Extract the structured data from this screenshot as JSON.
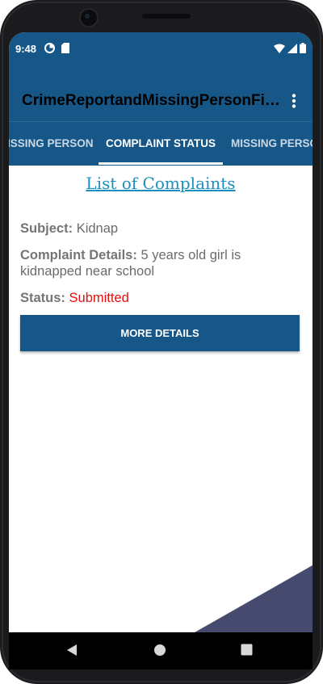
{
  "status_bar": {
    "time": "9:48",
    "left_icons": [
      "data-saver-icon",
      "sd-card-icon"
    ],
    "right_icons": [
      "wifi-icon",
      "signal-icon",
      "battery-icon"
    ]
  },
  "app_bar": {
    "title": "CrimeReportandMissingPersonFin…",
    "menu_icon": "more-vert-icon"
  },
  "tabs": [
    {
      "label": "ISSING PERSON",
      "selected": false
    },
    {
      "label": "COMPLAINT STATUS",
      "selected": true
    },
    {
      "label": "MISSING PERSO",
      "selected": false
    }
  ],
  "content": {
    "heading": "List of Complaints",
    "subject_label": "Subject:",
    "subject_value": "Kidnap",
    "details_label": "Complaint Details:",
    "details_value": "5 years old girl is kidnapped near school",
    "status_label": "Status:",
    "status_value": "Submitted",
    "more_button": "MORE DETAILS"
  },
  "colors": {
    "primary": "#175788",
    "heading_link": "#1a8fc0",
    "status_submitted": "#e01010",
    "wallpaper": "#454a6e"
  },
  "nav_bar": {
    "icons": [
      "back-icon",
      "home-icon",
      "recents-icon"
    ]
  }
}
